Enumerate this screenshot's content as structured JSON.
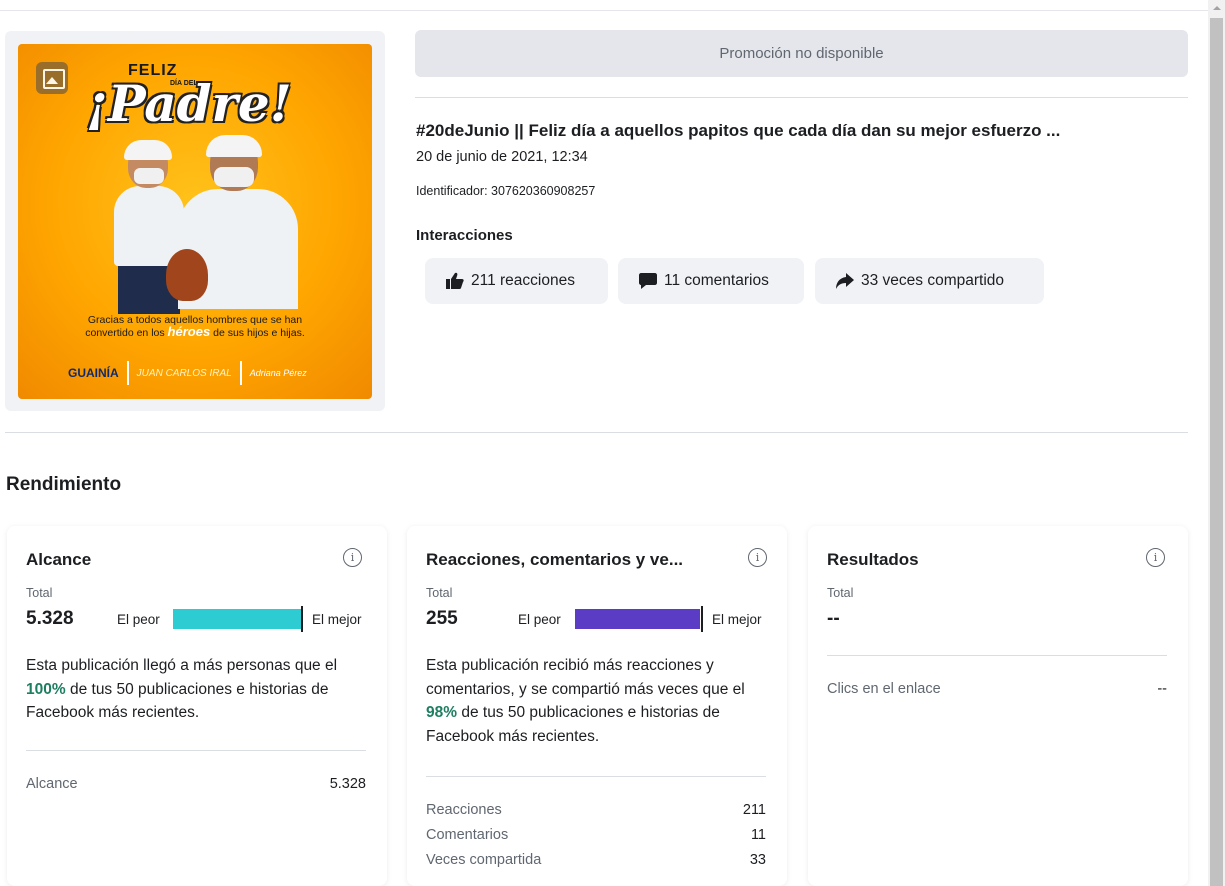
{
  "post": {
    "promotion_label": "Promoción no disponible",
    "title": "#20deJunio || Feliz día a aquellos papitos que cada día dan su mejor esfuerzo ...",
    "date": "20 de junio de 2021, 12:34",
    "id_text": "Identificador: 307620360908257",
    "image": {
      "feliz": "FELIZ",
      "dia_del": "DÍA DEL",
      "padre": "¡Padre!",
      "caption_line1": "Gracias a todos aquellos hombres que se han",
      "caption_pre": "convertido en los ",
      "caption_heroes": "héroes",
      "caption_post": " de sus hijos e hijas.",
      "logo1": "GUAINÍA",
      "logo2": "JUAN CARLOS IRAL",
      "logo3": "Adriana Pérez"
    }
  },
  "interactions": {
    "label": "Interacciones",
    "reactions": "211 reacciones",
    "comments": "11 comentarios",
    "shares": "33 veces compartido"
  },
  "performance": {
    "title": "Rendimiento",
    "cards": [
      {
        "title": "Alcance",
        "total_label": "Total",
        "total": "5.328",
        "worst": "El peor",
        "best": "El mejor",
        "bar_color": "#2dccd3",
        "bar_fill": 1.0,
        "desc_pre": "Esta publicación llegó a más personas que el ",
        "desc_pct": "100%",
        "desc_post": " de tus 50 publicaciones e historias de Facebook más recientes.",
        "rows": [
          {
            "label": "Alcance",
            "value": "5.328"
          }
        ]
      },
      {
        "title": "Reacciones, comentarios y ve...",
        "total_label": "Total",
        "total": "255",
        "worst": "El peor",
        "best": "El mejor",
        "bar_color": "#5b3cc4",
        "bar_fill": 0.98,
        "desc_pre": "Esta publicación recibió más reacciones y comentarios, y se compartió más veces que el ",
        "desc_pct": "98%",
        "desc_post": " de tus 50 publicaciones e historias de Facebook más recientes.",
        "rows": [
          {
            "label": "Reacciones",
            "value": "211"
          },
          {
            "label": "Comentarios",
            "value": "11"
          },
          {
            "label": "Veces compartida",
            "value": "33"
          }
        ]
      },
      {
        "title": "Resultados",
        "total_label": "Total",
        "total": "--",
        "rows": [
          {
            "label": "Clics en el enlace",
            "value": "--"
          }
        ]
      }
    ]
  }
}
